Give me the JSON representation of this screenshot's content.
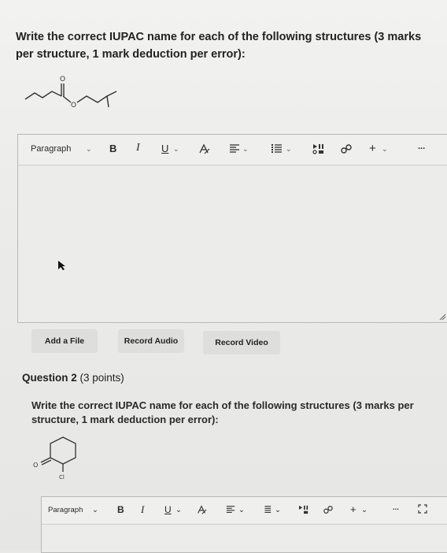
{
  "question1": {
    "prompt": "Write the correct IUPAC name for each of the following structures (3 marks per structure, 1 mark deduction per error):",
    "structure_atoms": [
      "O",
      "O"
    ],
    "editor": {
      "paragraph_label": "Paragraph",
      "bold": "B",
      "italic": "I",
      "underline": "U",
      "more": "..."
    },
    "buttons": {
      "add_file": "Add a File",
      "record_audio": "Record Audio",
      "record_video": "Record Video"
    }
  },
  "question2": {
    "title": "Question 2",
    "points": "(3 points)",
    "prompt": "Write the correct IUPAC name for each of the following structures (3 marks per structure, 1 mark deduction per error):",
    "structure_atoms": [
      "O",
      "Cl"
    ],
    "editor": {
      "paragraph_label": "Paragraph",
      "bold": "B",
      "italic": "I",
      "underline": "U",
      "more": "..."
    }
  },
  "colors": {
    "page_bg": "#ebebea",
    "editor_bg": "#ececea",
    "button_bg": "#dededc",
    "text": "#222222"
  }
}
